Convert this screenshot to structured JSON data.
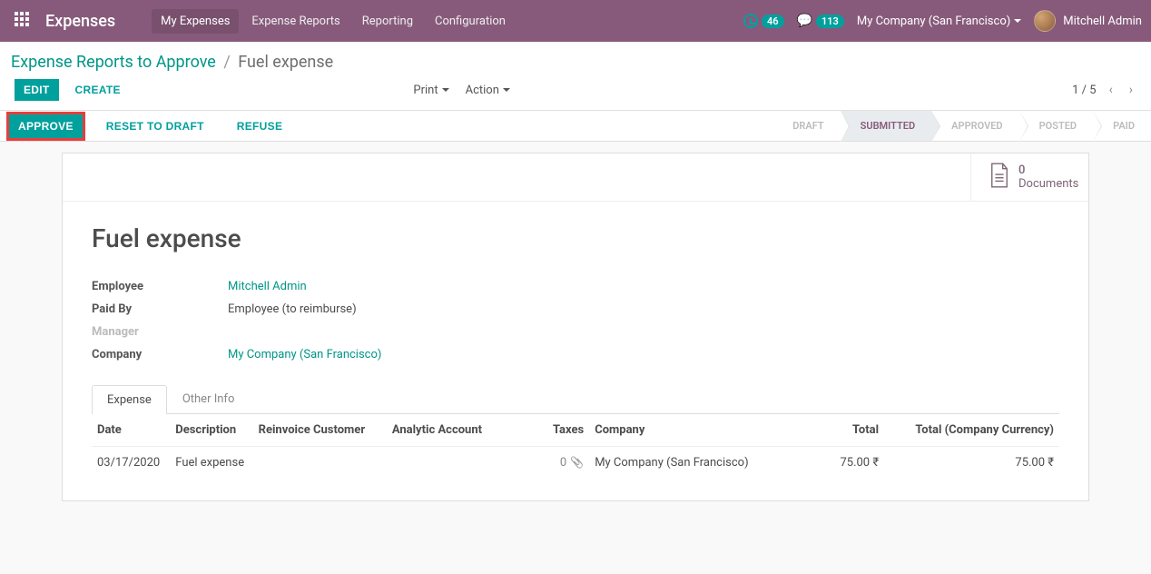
{
  "navbar": {
    "brand": "Expenses",
    "menu": [
      "My Expenses",
      "Expense Reports",
      "Reporting",
      "Configuration"
    ],
    "clock_count": "46",
    "chat_count": "113",
    "company": "My Company (San Francisco)",
    "user": "Mitchell Admin"
  },
  "breadcrumb": {
    "parent": "Expense Reports to Approve",
    "current": "Fuel expense"
  },
  "controls": {
    "edit": "EDIT",
    "create": "CREATE",
    "print": "Print",
    "action": "Action",
    "pager": "1 / 5"
  },
  "statusbar": {
    "approve": "APPROVE",
    "reset": "RESET TO DRAFT",
    "refuse": "REFUSE",
    "steps": [
      "DRAFT",
      "SUBMITTED",
      "APPROVED",
      "POSTED",
      "PAID"
    ]
  },
  "statbox": {
    "count": "0",
    "label": "Documents"
  },
  "record": {
    "title": "Fuel expense",
    "fields": {
      "employee_label": "Employee",
      "employee_value": "Mitchell Admin",
      "paidby_label": "Paid By",
      "paidby_value": "Employee (to reimburse)",
      "manager_label": "Manager",
      "manager_value": "",
      "company_label": "Company",
      "company_value": "My Company (San Francisco)"
    }
  },
  "tabs": [
    "Expense",
    "Other Info"
  ],
  "table": {
    "headers": {
      "date": "Date",
      "description": "Description",
      "reinvoice": "Reinvoice Customer",
      "analytic": "Analytic Account",
      "taxes": "Taxes",
      "company": "Company",
      "total": "Total",
      "total_cc": "Total (Company Currency)"
    },
    "row": {
      "date": "03/17/2020",
      "description": "Fuel expense",
      "reinvoice": "",
      "analytic": "",
      "attach": "0",
      "company": "My Company (San Francisco)",
      "total": "75.00 ₹",
      "total_cc": "75.00 ₹"
    }
  }
}
